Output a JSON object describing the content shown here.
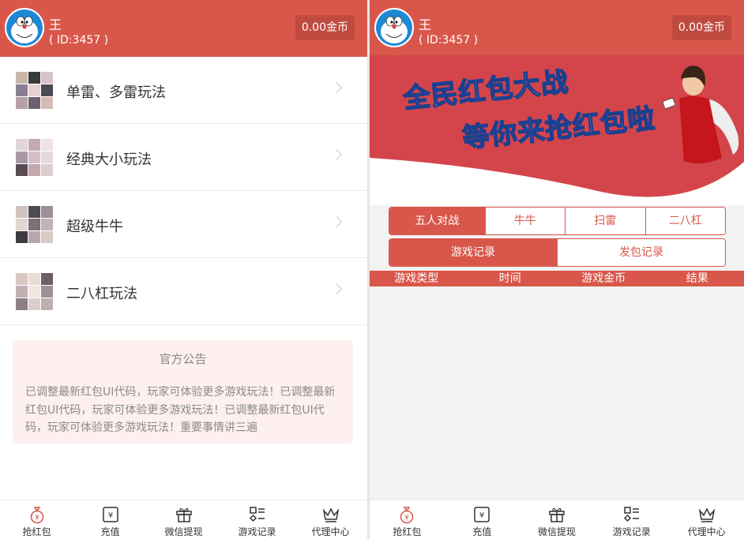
{
  "left": {
    "header": {
      "name": "王",
      "id_text": "( ID:3457 )",
      "coins": "0.00金币"
    },
    "games": [
      {
        "label": "单雷、多雷玩法"
      },
      {
        "label": "经典大小玩法"
      },
      {
        "label": "超级牛牛"
      },
      {
        "label": "二八杠玩法"
      }
    ],
    "notice": {
      "title": "官方公告",
      "body": "已调整最新红包UI代码，玩家可体验更多游戏玩法！已调整最新红包UI代码，玩家可体验更多游戏玩法！已调整最新红包UI代码，玩家可体验更多游戏玩法！重要事情讲三遍"
    }
  },
  "right": {
    "header": {
      "name": "王",
      "id_text": "( ID:3457 )",
      "coins": "0.00金币"
    },
    "banner": {
      "line1": "全民红包大战",
      "line2": "等你来抢红包啦"
    },
    "game_tabs": [
      "五人对战",
      "牛牛",
      "扫雷",
      "二八杠"
    ],
    "record_tabs": [
      "游戏记录",
      "发包记录"
    ],
    "table_headers": [
      "游戏类型",
      "时间",
      "游戏金币",
      "结果"
    ]
  },
  "nav": [
    "抢红包",
    "充值",
    "微信提现",
    "游戏记录",
    "代理中心"
  ],
  "colors": {
    "primary": "#d9574a",
    "coin_badge": "#c04a3f",
    "notice_bg": "#fdf0ef"
  }
}
